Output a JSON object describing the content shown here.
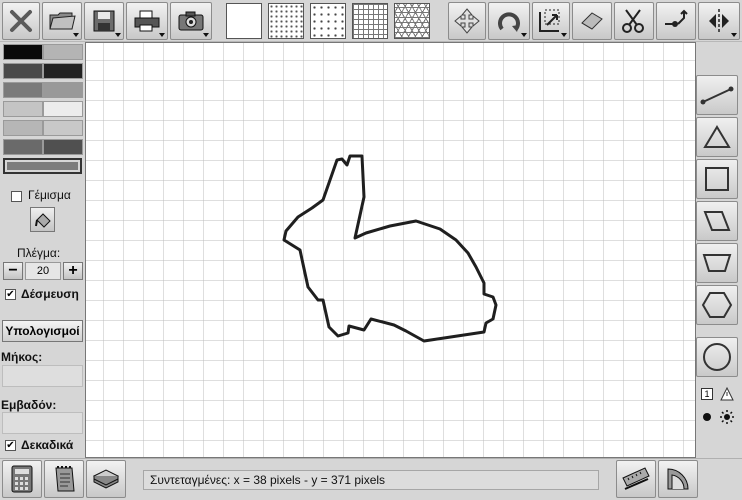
{
  "toolbar": {
    "tools": [
      {
        "name": "close-tool",
        "icon": "x-icon"
      },
      {
        "name": "open-tool",
        "icon": "folder-icon"
      },
      {
        "name": "save-tool",
        "icon": "floppy-disk-icon"
      },
      {
        "name": "print-tool",
        "icon": "printer-icon"
      },
      {
        "name": "camera-tool",
        "icon": "camera-icon"
      },
      {
        "name": "move-tool",
        "icon": "four-arrows-icon"
      },
      {
        "name": "rotate-tool",
        "icon": "rotate-icon"
      },
      {
        "name": "resize-tool",
        "icon": "resize-icon"
      },
      {
        "name": "eraser-tool",
        "icon": "eraser-icon"
      },
      {
        "name": "scissors-tool",
        "icon": "scissors-icon"
      },
      {
        "name": "point-tool",
        "icon": "point-arrow-icon"
      },
      {
        "name": "mirror-tool",
        "icon": "mirror-icon"
      }
    ],
    "patterns": [
      "blank",
      "dots-square",
      "dots-offset",
      "grid-square",
      "grid-triangle"
    ]
  },
  "palette": {
    "colors": [
      [
        "#0a0a0a",
        "#b4b4b4"
      ],
      [
        "#4a4a4a",
        "#222222"
      ],
      [
        "#7a7a7a",
        "#999999"
      ],
      [
        "#c4c4c4",
        "#ececec"
      ],
      [
        "#b6b6b6",
        "#c8c8c8"
      ],
      [
        "#6a6a6a",
        "#505050"
      ]
    ],
    "current_color": "#7c7c7c"
  },
  "fill": {
    "label": "Γέμισμα",
    "checked": false
  },
  "grid": {
    "label": "Πλέγμα:",
    "value": "20",
    "minus": "−",
    "plus": "+"
  },
  "snap": {
    "label": "Δέσμευση",
    "checked": true
  },
  "calc": {
    "button": "Υπολογισμοί",
    "length_label": "Μήκος:",
    "length_value": "",
    "area_label": "Εμβαδόν:",
    "area_value": ""
  },
  "decimals": {
    "label": "Δεκαδικά",
    "checked": true
  },
  "shapes": [
    "segment",
    "triangle",
    "square",
    "parallelogram",
    "trapezoid",
    "hexagon",
    "circle"
  ],
  "status": {
    "text": "Συντεταγμένες:  x = 38 pixels  -  y = 371 pixels"
  },
  "bottom_tools": [
    {
      "name": "calculator-tool",
      "icon": "calculator-icon"
    },
    {
      "name": "notepad-tool",
      "icon": "notepad-icon"
    },
    {
      "name": "book-tool",
      "icon": "book-icon"
    },
    {
      "name": "ruler-tool",
      "icon": "ruler-icon"
    },
    {
      "name": "protractor-tool",
      "icon": "protractor-icon"
    }
  ],
  "canvas": {
    "grid_spacing": 20,
    "shape": "rabbit outline"
  }
}
